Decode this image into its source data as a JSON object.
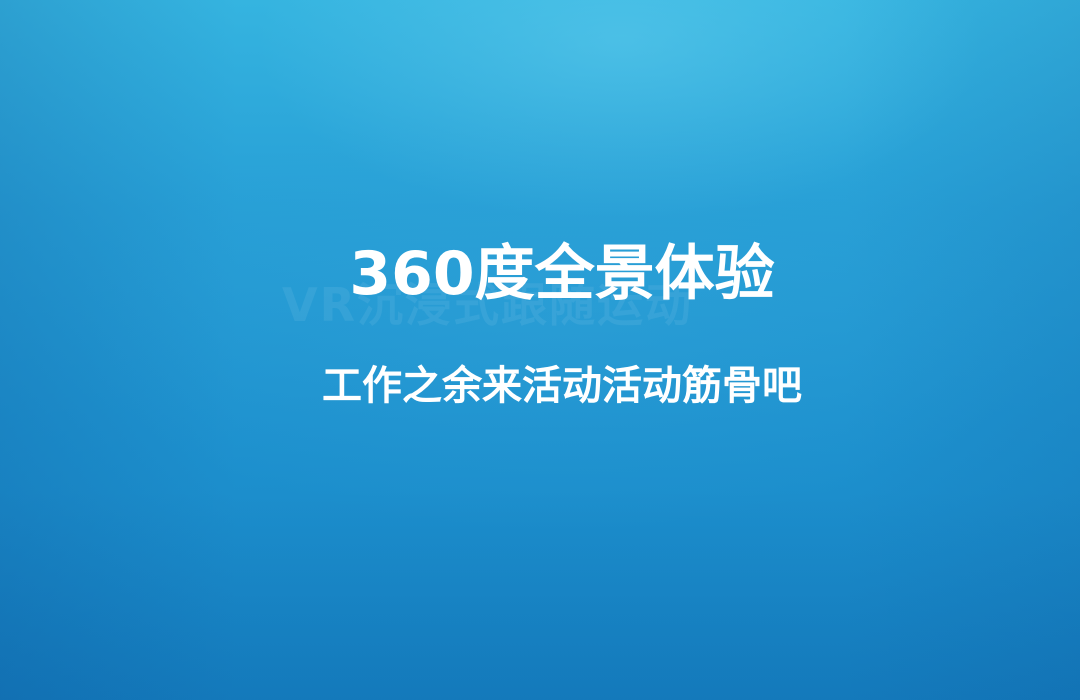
{
  "slide": {
    "watermark": "VR沉浸式跟随运动",
    "title": "360度全景体验",
    "subtitle": "工作之余来活动活动筋骨吧"
  },
  "colors": {
    "background_top": "#35b4e0",
    "background_bottom": "#1684c5",
    "text": "#ffffff"
  }
}
